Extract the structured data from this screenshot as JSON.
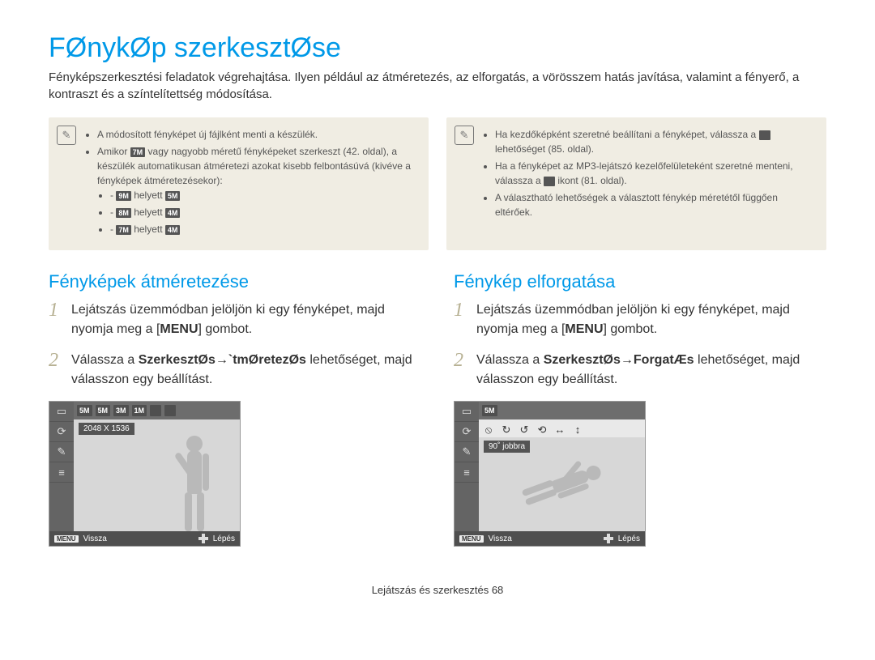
{
  "title": "FØnykØp szerkesztØse",
  "intro": "Fényképszerkesztési feladatok végrehajtása. Ilyen például az átméretezés, az elforgatás, a vörösszem hatás javítása, valamint a fényerő, a kontraszt és a színtelítettség módosítása.",
  "note_left": {
    "items": [
      "A módosított fényképet új fájlként menti a készülék.",
      "Amikor       vagy nagyobb méretű fényképeket szerkeszt (42. oldal), a készülék automatikusan átméretezi azokat kisebb felbontásúvá (kivéve a fényképek átméretezésekor):"
    ],
    "chip_before_second": "7M",
    "sub": [
      {
        "a": "9M",
        "b": "5M"
      },
      {
        "a": "8M",
        "b": "4M"
      },
      {
        "a": "7M",
        "b": "4M"
      }
    ],
    "helyett": "helyett"
  },
  "note_right": {
    "items": [
      "Ha kezdőképként szeretné beállítani a fényképet, válassza a       lehetőséget (85. oldal).",
      "Ha a fényképet az MP3-lejátszó kezelőfelületeként szeretné menteni, válassza a       ikont (81. oldal).",
      "A választható lehetőségek a választott fénykép méretétől függően eltérőek."
    ]
  },
  "left_col": {
    "subhead": "Fényképek átméretezése",
    "step1": "Lejátszás üzemmódban jelöljön ki egy fényképet, majd nyomja meg a [",
    "step1_btn": "MENU",
    "step1_after": "] gombot.",
    "step2_pre": "Válassza a ",
    "step2_bold1": "SzerkesztØs",
    "step2_arrow": " → ",
    "step2_bold2": "`tmØretezØs",
    "step2_post": " lehetőséget, majd válasszon egy beállítást.",
    "opts": [
      "5M",
      "5M",
      "3M",
      "1M"
    ],
    "caption": "2048 X 1536"
  },
  "right_col": {
    "subhead": "Fénykép elforgatása",
    "step1": "Lejátszás üzemmódban jelöljön ki egy fényképet, majd nyomja meg a [",
    "step1_btn": "MENU",
    "step1_after": "] gombot.",
    "step2_pre": "Válassza a ",
    "step2_bold1": "SzerkesztØs",
    "step2_arrow": " → ",
    "step2_bold2": "ForgatÆs",
    "step2_post": " lehetőséget, majd válasszon egy beállítást.",
    "optchip": "5M",
    "caption": "90˚ jobbra"
  },
  "screen_common": {
    "back": "Vissza",
    "enter": "Lépés",
    "menu": "MENU"
  },
  "footer": "Lejátszás és szerkesztés  68"
}
